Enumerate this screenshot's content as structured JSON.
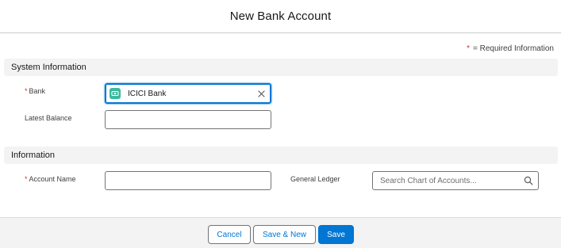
{
  "modal": {
    "title": "New Bank Account"
  },
  "legend": {
    "star": "*",
    "text": "= Required Information"
  },
  "sections": {
    "system": {
      "title": "System Information"
    },
    "info": {
      "title": "Information"
    }
  },
  "fields": {
    "bank": {
      "required": "*",
      "label": "Bank",
      "value": "ICICI Bank"
    },
    "latest_balance": {
      "label": "Latest Balance",
      "value": ""
    },
    "account_name": {
      "required": "*",
      "label": "Account Name",
      "value": ""
    },
    "general_ledger": {
      "label": "General Ledger",
      "placeholder": "Search Chart of Accounts..."
    }
  },
  "footer": {
    "cancel": "Cancel",
    "save_new": "Save & New",
    "save": "Save"
  },
  "colors": {
    "brand": "#0176d3",
    "required": "#c23934",
    "bank_icon": "#3bba9f"
  },
  "icons": {
    "bank": "bank-account-icon",
    "clear": "close-icon",
    "search": "search-icon"
  }
}
